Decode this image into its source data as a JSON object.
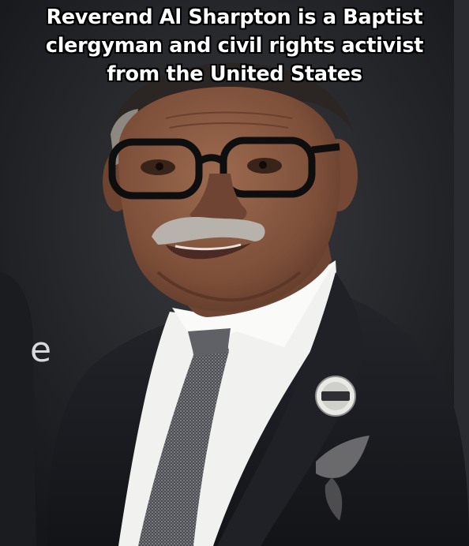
{
  "caption": {
    "line1": "Reverend Al Sharpton is a Baptist",
    "line2": "clergyman and civil rights activist",
    "line3": "from the United States"
  },
  "backdrop": {
    "letter": "e"
  },
  "colors": {
    "background": "#222327",
    "suit": "#1a1b20",
    "shirt": "#f2f2f0",
    "tie": "#5b5d62",
    "skin": "#8a5a42",
    "hair": "#c9c6c0",
    "glasses": "#111111",
    "caption_text": "#ffffff",
    "caption_outline": "#000000"
  }
}
